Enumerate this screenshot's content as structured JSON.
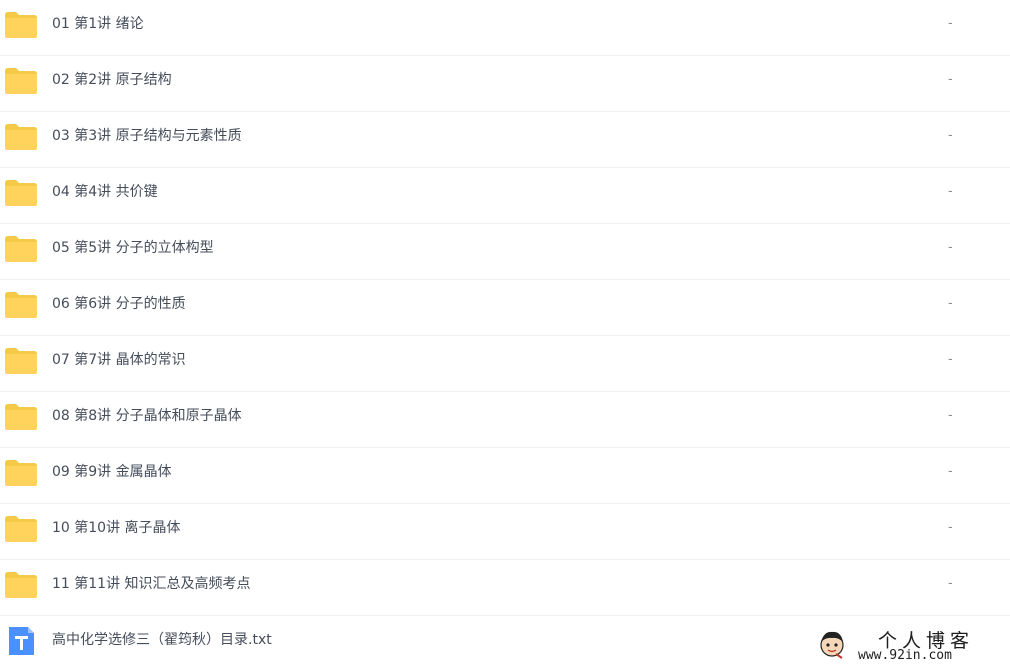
{
  "files": [
    {
      "type": "folder",
      "icon": "folder-icon",
      "name": "01 第1讲 绪论",
      "size": "-"
    },
    {
      "type": "folder",
      "icon": "folder-icon",
      "name": "02 第2讲 原子结构",
      "size": "-"
    },
    {
      "type": "folder",
      "icon": "folder-icon",
      "name": "03 第3讲 原子结构与元素性质",
      "size": "-"
    },
    {
      "type": "folder",
      "icon": "folder-icon",
      "name": "04 第4讲 共价键",
      "size": "-"
    },
    {
      "type": "folder",
      "icon": "folder-icon",
      "name": "05 第5讲 分子的立体构型",
      "size": "-"
    },
    {
      "type": "folder",
      "icon": "folder-icon",
      "name": "06 第6讲 分子的性质",
      "size": "-"
    },
    {
      "type": "folder",
      "icon": "folder-icon",
      "name": "07 第7讲 晶体的常识",
      "size": "-"
    },
    {
      "type": "folder",
      "icon": "folder-icon",
      "name": "08 第8讲 分子晶体和原子晶体",
      "size": "-"
    },
    {
      "type": "folder",
      "icon": "folder-icon",
      "name": "09 第9讲 金属晶体",
      "size": "-"
    },
    {
      "type": "folder",
      "icon": "folder-icon",
      "name": "10 第10讲 离子晶体",
      "size": "-"
    },
    {
      "type": "folder",
      "icon": "folder-icon",
      "name": "11 第11讲 知识汇总及高频考点",
      "size": "-"
    },
    {
      "type": "txt",
      "icon": "text-file-icon",
      "name": "高中化学选修三（翟筠秋）目录.txt",
      "size": ""
    }
  ],
  "watermark": {
    "title": "个人博客",
    "url": "www.92in.com",
    "icon": "avatar-icon"
  },
  "colors": {
    "folder": "#ffd35c",
    "folder_tab": "#f7c948",
    "txt_icon": "#4a90ff",
    "text": "#454d5a",
    "divider": "#f1f2f4"
  }
}
